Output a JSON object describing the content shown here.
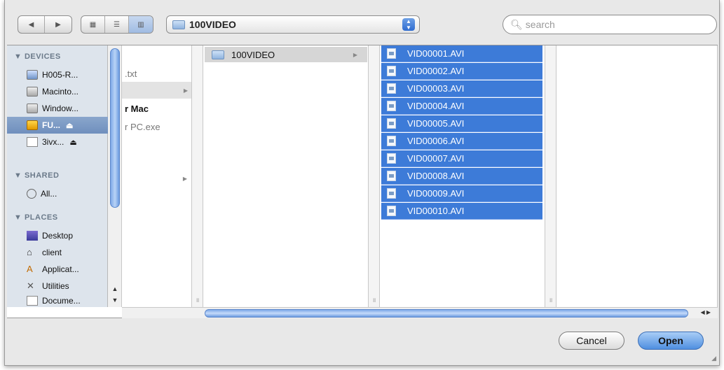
{
  "toolbar": {
    "back_icon": "back-arrow-icon",
    "forward_icon": "forward-arrow-icon",
    "view_icons": [
      "icon-view-icon",
      "list-view-icon",
      "column-view-icon"
    ],
    "path_label": "100VIDEO",
    "search_placeholder": "search"
  },
  "sidebar": {
    "sections": [
      {
        "title": "▼ DEVICES"
      },
      {
        "title": "▼ SHARED"
      },
      {
        "title": "▼ PLACES"
      }
    ],
    "devices": [
      {
        "label": "H005-R...",
        "icon": "display-icon"
      },
      {
        "label": "Macinto...",
        "icon": "disk-icon"
      },
      {
        "label": "Window...",
        "icon": "disk-icon"
      },
      {
        "label": "FU...",
        "icon": "volume-icon",
        "eject": "⏏"
      },
      {
        "label": "3ivx...",
        "icon": "blank-disk-icon",
        "eject": "⏏"
      }
    ],
    "shared": [
      {
        "label": "All...",
        "icon": "network-icon"
      }
    ],
    "places": [
      {
        "label": "Desktop",
        "icon": "desktop-icon"
      },
      {
        "label": "client",
        "icon": "home-icon"
      },
      {
        "label": "Applicat...",
        "icon": "applications-icon"
      },
      {
        "label": "Utilities",
        "icon": "utilities-icon"
      },
      {
        "label": "Docume...",
        "icon": "documents-icon"
      }
    ]
  },
  "column1": [
    {
      "label": ".txt"
    },
    {
      "label": ""
    },
    {
      "label": "r Mac"
    },
    {
      "label": "r PC.exe"
    }
  ],
  "column2": {
    "folder": "100VIDEO"
  },
  "files": [
    "VID00001.AVI",
    "VID00002.AVI",
    "VID00003.AVI",
    "VID00004.AVI",
    "VID00005.AVI",
    "VID00006.AVI",
    "VID00007.AVI",
    "VID00008.AVI",
    "VID00009.AVI",
    "VID00010.AVI"
  ],
  "buttons": {
    "cancel": "Cancel",
    "open": "Open"
  },
  "colors": {
    "selection": "#3d7bd8",
    "accent": "#4f8fe0"
  }
}
